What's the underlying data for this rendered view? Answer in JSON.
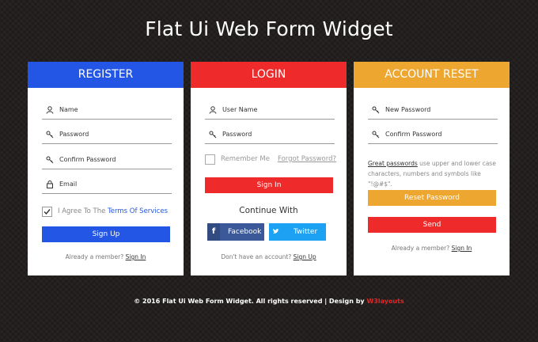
{
  "page_title": "Flat Ui Web Form Widget",
  "colors": {
    "register": "#2456e6",
    "login": "#ee2a2a",
    "reset": "#eda62f",
    "facebook": "#3b5999",
    "twitter": "#1da1f2"
  },
  "register": {
    "header": "REGISTER",
    "fields": [
      "Name",
      "Password",
      "Confirm Password",
      "Email"
    ],
    "agree_prefix": "I Agree To The",
    "agree_link": "Terms Of Services",
    "button": "Sign Up",
    "member_text": "Already a member?",
    "member_link": "Sign In"
  },
  "login": {
    "header": "LOGIN",
    "fields": [
      "User Name",
      "Password"
    ],
    "remember": "Remember Me",
    "forgot": "Forgot Password?",
    "button": "Sign In",
    "continue_with": "Continue With",
    "facebook": "Facebook",
    "twitter": "Twitter",
    "no_account_text": "Don't have an account?",
    "no_account_link": "Sign Up"
  },
  "reset": {
    "header": "ACCOUNT RESET",
    "fields": [
      "New Password",
      "Confirm Password"
    ],
    "hint_link": "Great passwords",
    "hint_text": "use upper and lower case characters, numbers and symbols like \"!@#$\".",
    "reset_button": "Reset Password",
    "send_button": "Send",
    "member_text": "Already a member?",
    "member_link": "Sign In"
  },
  "footer": {
    "text": "© 2016 Flat Ui Web Form Widget. All rights reserved | Design by",
    "link": "W3layouts"
  }
}
